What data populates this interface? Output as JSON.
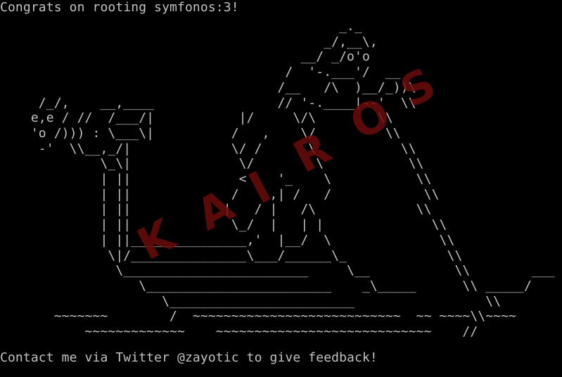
{
  "terminal": {
    "background": "#000000",
    "text_color": "#c2c2c2",
    "header": "Congrats on rooting symfonos:3!",
    "ascii_art": [
      "                                            _._",
      "                                          _/,__\\,",
      "                                       __/ _/o'o",
      "                                     /  '-.___'/  __",
      "                                    /__   /\\  )__/_))\\",
      "     /_/,    __,____                // '-.____|--'  \\\\",
      "    e,e / //  /___/|           |/     \\/\\        \\\\",
      "    'o /))) : \\___\\|          /   ,    \\/         \\\\",
      "     -'  \\\\__,_/|             \\/ /      \\           \\\\",
      "             \\_\\|              \\/        \\           \\\\",
      "             | ||              <    '_    \\           \\\\",
      "             | ||             /    ,| /   /            \\\\",
      "             | ||            |   / |   /\\             \\\\",
      "             | ||             \\_/  |   | |              \\\\",
      "             | ||_______________,'  |__/  \\              \\\\",
      "              \\|/_______________\\___/______\\_             \\\\",
      "               \\________________________     \\__           \\\\        ___",
      "                  \\________________________    _\\_____      \\\\ _____/",
      "                     \\________________________                 \\\\",
      "       ~~~~~~~        /  ~~~~~~~~~~~~~~~~~~~~~~~~~~~  ~~ ~~~~\\\\~~~~",
      "           ~~~~~~~~~~~~~    ~~~~~~~~~~~~~~~~~~~~~~~~~~~~    //"
    ],
    "footer": "Contact me via Twitter @zayotic to give feedback!"
  },
  "watermark": {
    "letters": [
      "K",
      "A",
      "I",
      "R",
      "O",
      "S"
    ],
    "color": "#6b0c0c"
  }
}
